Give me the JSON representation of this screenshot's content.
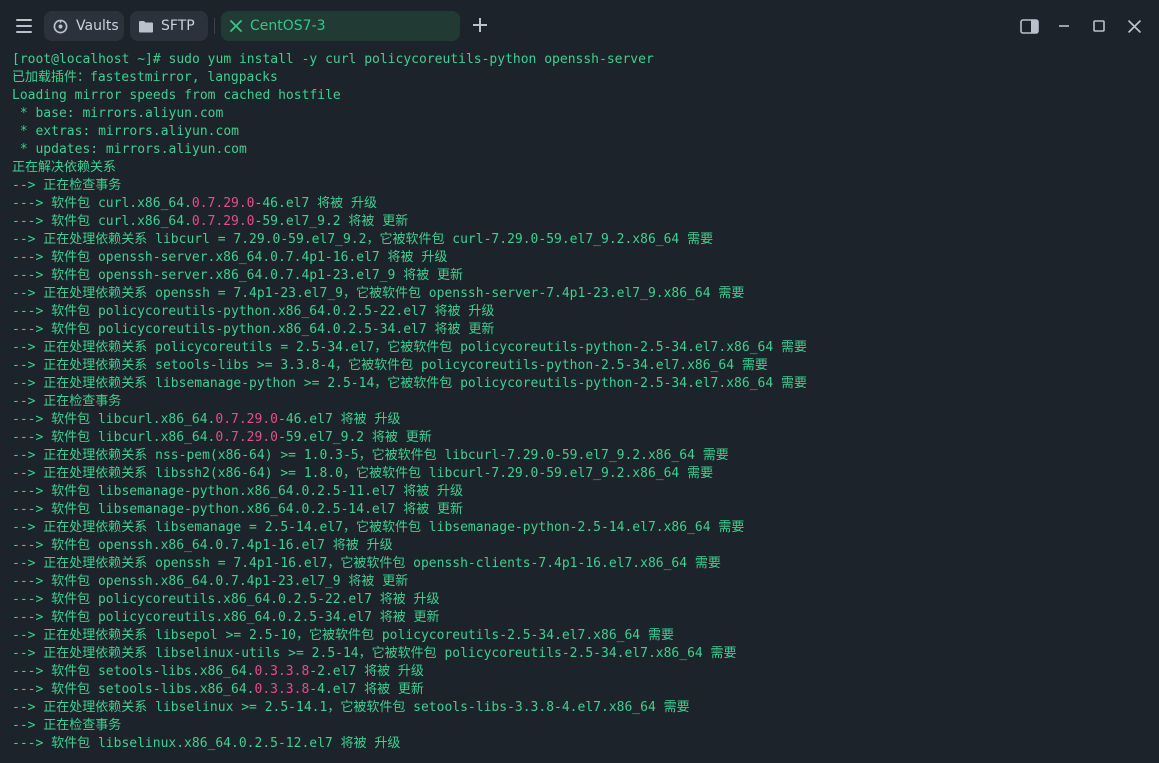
{
  "tabs": [
    {
      "label": "Vaults",
      "icon": "vault-icon"
    },
    {
      "label": "SFTP",
      "icon": "folder-icon"
    },
    {
      "label": "CentOS7-3",
      "icon": "close-icon",
      "active": true
    }
  ],
  "window_controls": [
    "split-view-icon",
    "minimize-icon",
    "maximize-icon",
    "close-window-icon"
  ],
  "colors": {
    "accent": "#3fcf8e",
    "highlight": "#e0508a",
    "background": "#1d232b"
  },
  "terminal_lines": [
    [
      "[root@localhost ~]# sudo yum install -y curl policycoreutils-python openssh-server"
    ],
    [
      "已加载插件：fastestmirror, langpacks"
    ],
    [
      "Loading mirror speeds from cached hostfile"
    ],
    [
      " * base: mirrors.aliyun.com"
    ],
    [
      " * extras: mirrors.aliyun.com"
    ],
    [
      " * updates: mirrors.aliyun.com"
    ],
    [
      "正在解决依赖关系"
    ],
    [
      "--> 正在检查事务"
    ],
    [
      "---> 软件包 curl.x86_64.",
      "0.7.29.0",
      "-46.el7 将被 升级"
    ],
    [
      "---> 软件包 curl.x86_64.",
      "0.7.29.0",
      "-59.el7_9.2 将被 更新"
    ],
    [
      "--> 正在处理依赖关系 libcurl = 7.29.0-59.el7_9.2，它被软件包 curl-7.29.0-59.el7_9.2.x86_64 需要"
    ],
    [
      "---> 软件包 openssh-server.x86_64.0.7.4p1-16.el7 将被 升级"
    ],
    [
      "---> 软件包 openssh-server.x86_64.0.7.4p1-23.el7_9 将被 更新"
    ],
    [
      "--> 正在处理依赖关系 openssh = 7.4p1-23.el7_9，它被软件包 openssh-server-7.4p1-23.el7_9.x86_64 需要"
    ],
    [
      "---> 软件包 policycoreutils-python.x86_64.0.2.5-22.el7 将被 升级"
    ],
    [
      "---> 软件包 policycoreutils-python.x86_64.0.2.5-34.el7 将被 更新"
    ],
    [
      "--> 正在处理依赖关系 policycoreutils = 2.5-34.el7，它被软件包 policycoreutils-python-2.5-34.el7.x86_64 需要"
    ],
    [
      "--> 正在处理依赖关系 setools-libs >= 3.3.8-4，它被软件包 policycoreutils-python-2.5-34.el7.x86_64 需要"
    ],
    [
      "--> 正在处理依赖关系 libsemanage-python >= 2.5-14，它被软件包 policycoreutils-python-2.5-34.el7.x86_64 需要"
    ],
    [
      "--> 正在检查事务"
    ],
    [
      "---> 软件包 libcurl.x86_64.",
      "0.7.29.0",
      "-46.el7 将被 升级"
    ],
    [
      "---> 软件包 libcurl.x86_64.",
      "0.7.29.0",
      "-59.el7_9.2 将被 更新"
    ],
    [
      "--> 正在处理依赖关系 nss-pem(x86-64) >= 1.0.3-5，它被软件包 libcurl-7.29.0-59.el7_9.2.x86_64 需要"
    ],
    [
      "--> 正在处理依赖关系 libssh2(x86-64) >= 1.8.0，它被软件包 libcurl-7.29.0-59.el7_9.2.x86_64 需要"
    ],
    [
      "---> 软件包 libsemanage-python.x86_64.0.2.5-11.el7 将被 升级"
    ],
    [
      "---> 软件包 libsemanage-python.x86_64.0.2.5-14.el7 将被 更新"
    ],
    [
      "--> 正在处理依赖关系 libsemanage = 2.5-14.el7，它被软件包 libsemanage-python-2.5-14.el7.x86_64 需要"
    ],
    [
      "---> 软件包 openssh.x86_64.0.7.4p1-16.el7 将被 升级"
    ],
    [
      "--> 正在处理依赖关系 openssh = 7.4p1-16.el7，它被软件包 openssh-clients-7.4p1-16.el7.x86_64 需要"
    ],
    [
      "---> 软件包 openssh.x86_64.0.7.4p1-23.el7_9 将被 更新"
    ],
    [
      "---> 软件包 policycoreutils.x86_64.0.2.5-22.el7 将被 升级"
    ],
    [
      "---> 软件包 policycoreutils.x86_64.0.2.5-34.el7 将被 更新"
    ],
    [
      "--> 正在处理依赖关系 libsepol >= 2.5-10，它被软件包 policycoreutils-2.5-34.el7.x86_64 需要"
    ],
    [
      "--> 正在处理依赖关系 libselinux-utils >= 2.5-14，它被软件包 policycoreutils-2.5-34.el7.x86_64 需要"
    ],
    [
      "---> 软件包 setools-libs.x86_64.",
      "0.3.3.8",
      "-2.el7 将被 升级"
    ],
    [
      "---> 软件包 setools-libs.x86_64.",
      "0.3.3.8",
      "-4.el7 将被 更新"
    ],
    [
      "--> 正在处理依赖关系 libselinux >= 2.5-14.1，它被软件包 setools-libs-3.3.8-4.el7.x86_64 需要"
    ],
    [
      "--> 正在检查事务"
    ],
    [
      "---> 软件包 libselinux.x86_64.0.2.5-12.el7 将被 升级"
    ]
  ]
}
